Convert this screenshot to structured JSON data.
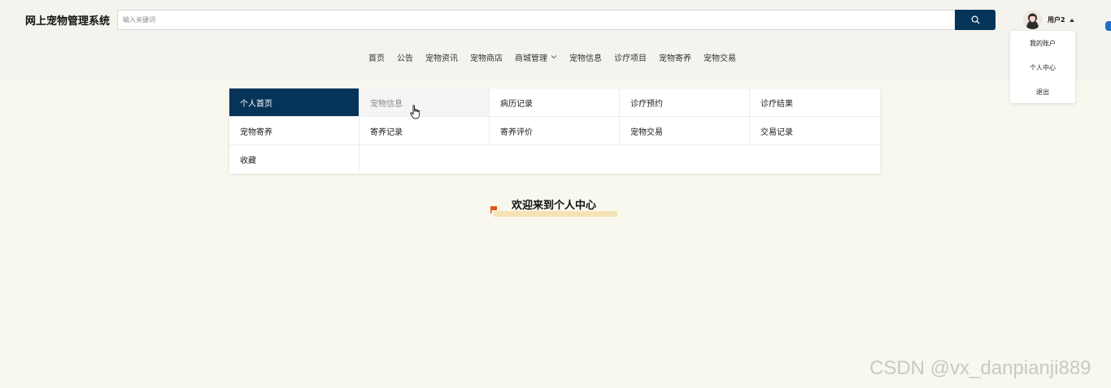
{
  "header": {
    "site_title": "网上宠物管理系统",
    "search": {
      "placeholder": "输入关键词",
      "value": ""
    },
    "user": {
      "name": "用户2",
      "dropdown": [
        "我的账户",
        "个人中心",
        "退出"
      ]
    }
  },
  "nav": {
    "items": [
      "首页",
      "公告",
      "宠物资讯",
      "宠物商店",
      "商城管理",
      "宠物信息",
      "诊疗项目",
      "宠物寄养",
      "宠物交易"
    ]
  },
  "menu": {
    "rows": [
      [
        "个人首页",
        "宠物信息",
        "病历记录",
        "诊疗预约",
        "诊疗结果"
      ],
      [
        "宠物寄养",
        "寄养记录",
        "寄养评价",
        "宠物交易",
        "交易记录"
      ],
      [
        "收藏"
      ]
    ],
    "active": "个人首页",
    "hovered": "宠物信息"
  },
  "welcome": {
    "title": "欢迎来到个人中心"
  },
  "watermark": "CSDN @vx_danpianji889",
  "colors": {
    "primary": "#063459",
    "page_bg": "#f8f8ee",
    "header_bg": "#f4f3ee",
    "accent_bar": "#f5e3b5",
    "flag": "#e8521d"
  }
}
